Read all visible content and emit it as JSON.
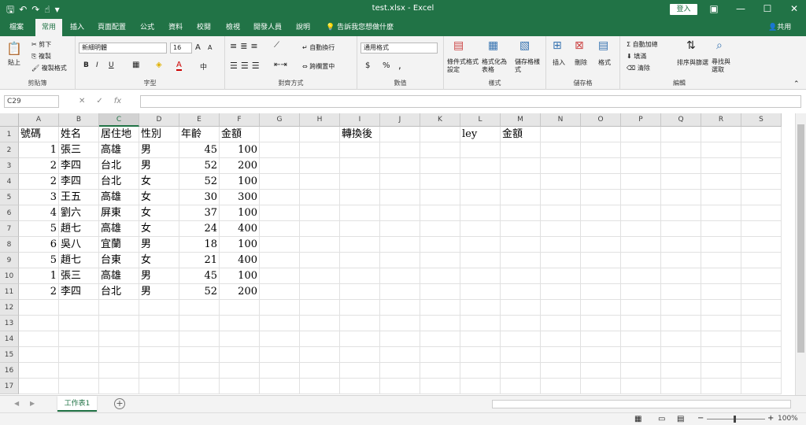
{
  "window": {
    "title": "test.xlsx  -  Excel",
    "login_label": "登入",
    "share_label": "共用"
  },
  "qat": {
    "save_icon": "save-icon",
    "undo_icon": "undo-icon",
    "redo_icon": "redo-icon"
  },
  "tabs": [
    "檔案",
    "常用",
    "插入",
    "頁面配置",
    "公式",
    "資料",
    "校閱",
    "檢視",
    "開發人員",
    "說明"
  ],
  "active_tab": "常用",
  "tell_me": "告訴我您想做什麼",
  "ribbon": {
    "clipboard": {
      "paste": "貼上",
      "cut": "剪下",
      "copy": "複製",
      "format_painter": "複製格式",
      "label": "剪貼簿"
    },
    "font": {
      "name": "新細明體",
      "size": "16",
      "grow": "A",
      "shrink": "A",
      "bold": "B",
      "italic": "I",
      "underline": "U",
      "font_color_letter": "A",
      "phonetic": "中",
      "label": "字型"
    },
    "alignment": {
      "wrap": "自動換行",
      "merge": "跨欄置中",
      "label": "對齊方式"
    },
    "number": {
      "format": "通用格式",
      "currency": "$",
      "percent": "%",
      "comma": ",",
      "label": "數值"
    },
    "styles": {
      "conditional": "條件式格式設定",
      "table": "格式化為表格",
      "cell_styles": "儲存格樣式",
      "label": "樣式"
    },
    "cells": {
      "insert": "插入",
      "delete": "刪除",
      "format": "格式",
      "label": "儲存格"
    },
    "editing": {
      "autosum": "自動加總",
      "fill": "填滿",
      "clear": "清除",
      "sort": "排序與篩選",
      "find": "尋找與選取",
      "label": "編輯"
    }
  },
  "formula_bar": {
    "name_box": "C29",
    "cancel": "✕",
    "enter": "✓",
    "fx": "fx",
    "value": ""
  },
  "columns": [
    "A",
    "B",
    "C",
    "D",
    "E",
    "F",
    "G",
    "H",
    "I",
    "J",
    "K",
    "L",
    "M",
    "N",
    "O",
    "P",
    "Q",
    "R",
    "S"
  ],
  "rows": [
    "1",
    "2",
    "3",
    "4",
    "5",
    "6",
    "7",
    "8",
    "9",
    "10",
    "11",
    "12",
    "13",
    "14",
    "15",
    "16",
    "17"
  ],
  "cells": {
    "A1": "號碼",
    "B1": "姓名",
    "C1": "居住地",
    "D1": "性別",
    "E1": "年齡",
    "F1": "金額",
    "I1": "轉換後",
    "L1": "ley",
    "M1": "金額",
    "A2": "1",
    "B2": "張三",
    "C2": "高雄",
    "D2": "男",
    "E2": "45",
    "F2": "100",
    "A3": "2",
    "B3": "李四",
    "C3": "台北",
    "D3": "男",
    "E3": "52",
    "F3": "200",
    "A4": "2",
    "B4": "李四",
    "C4": "台北",
    "D4": "女",
    "E4": "52",
    "F4": "100",
    "A5": "3",
    "B5": "王五",
    "C5": "高雄",
    "D5": "女",
    "E5": "30",
    "F5": "300",
    "A6": "4",
    "B6": "劉六",
    "C6": "屏東",
    "D6": "女",
    "E6": "37",
    "F6": "100",
    "A7": "5",
    "B7": "趙七",
    "C7": "高雄",
    "D7": "女",
    "E7": "24",
    "F7": "400",
    "A8": "6",
    "B8": "吳八",
    "C8": "宜蘭",
    "D8": "男",
    "E8": "18",
    "F8": "100",
    "A9": "5",
    "B9": "趙七",
    "C9": "台東",
    "D9": "女",
    "E9": "21",
    "F9": "400",
    "A10": "1",
    "B10": "張三",
    "C10": "高雄",
    "D10": "男",
    "E10": "45",
    "F10": "100",
    "A11": "2",
    "B11": "李四",
    "C11": "台北",
    "D11": "男",
    "E11": "52",
    "F11": "200"
  },
  "numeric_columns": [
    "A",
    "E",
    "F"
  ],
  "sheets": [
    "工作表1"
  ],
  "status": {
    "zoom": "100%"
  }
}
